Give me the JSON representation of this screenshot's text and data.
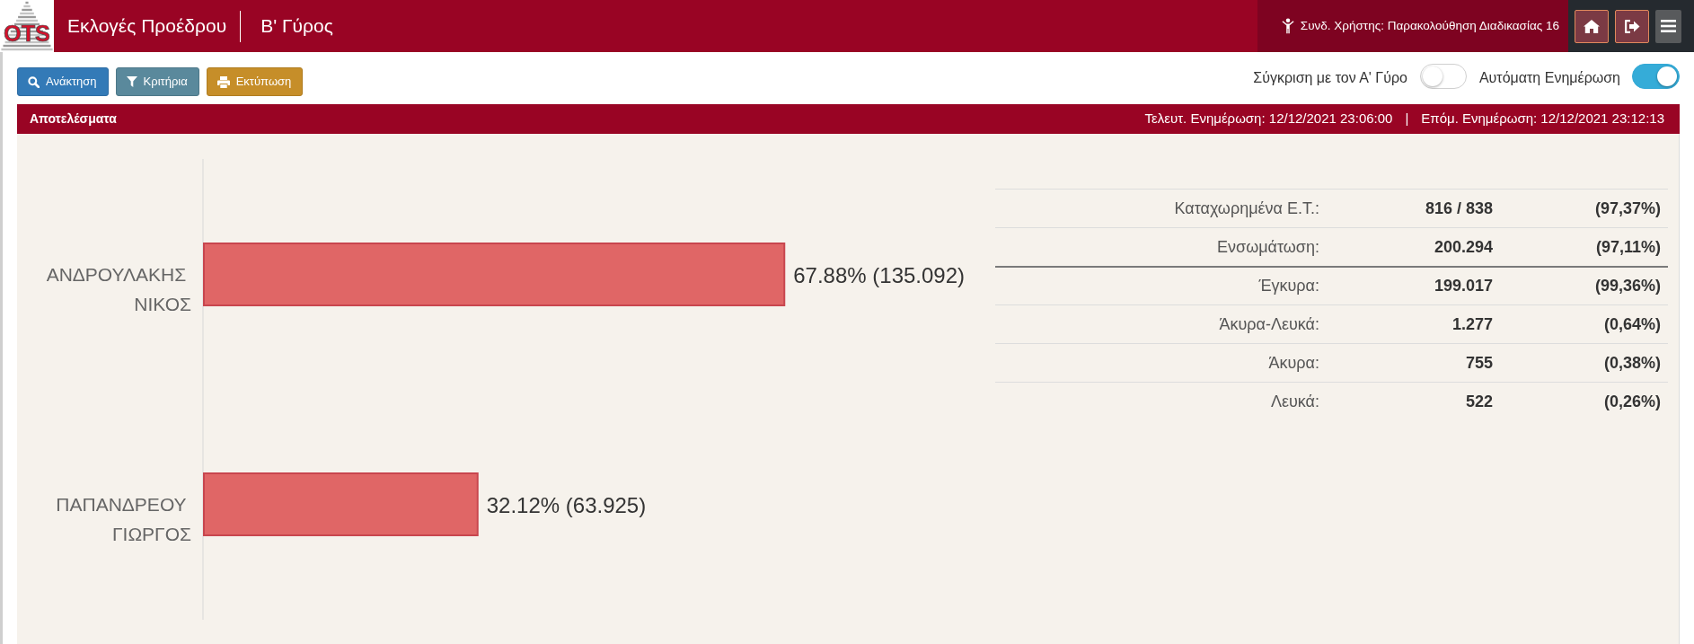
{
  "header": {
    "logo": "OTS",
    "title": "Εκλογές Προέδρου",
    "subtitle": "Β' Γύρος",
    "user": "Συνδ. Χρήστης: Παρακολούθηση Διαδικασίας 16"
  },
  "toolbar": {
    "buttons": [
      {
        "label": "Ανάκτηση",
        "kind": "search"
      },
      {
        "label": "Κριτήρια",
        "kind": "filter"
      },
      {
        "label": "Εκτύπωση",
        "kind": "print"
      }
    ]
  },
  "toggles": [
    {
      "label": "Σύγκριση με τον Α' Γύρο",
      "on": false
    },
    {
      "label": "Αυτόματη Ενημέρωση",
      "on": true
    }
  ],
  "results": {
    "title": "Αποτελέσματα",
    "last_update": "Τελευτ. Ενημέρωση: 12/12/2021 23:06:00",
    "separator": "|",
    "next_update": "Επόμ. Ενημέρωση: 12/12/2021 23:12:13",
    "chart_data": {
      "type": "bar",
      "orientation": "horizontal",
      "categories": [
        "ΑΝΔΡΟΥΛΑΚΗΣ ΝΙΚΟΣ",
        "ΠΑΠΑΝΔΡΕΟΥ ΓΙΩΡΓΟΣ"
      ],
      "values": [
        67.88,
        32.12
      ],
      "data_labels": true,
      "value_labels": [
        "67.88% (135.092)",
        "32.12% (63.925)"
      ]
    },
    "stats": {
      "sections": [
        {
          "rows": [
            {
              "label": "Καταχωρημένα Ε.Τ.:",
              "value": "816 / 838",
              "percent": "(97,37%)"
            },
            {
              "label": "Ενσωμάτωση:",
              "value": "200.294",
              "percent": "(97,11%)"
            }
          ]
        },
        {
          "rows": [
            {
              "label": "Έγκυρα:",
              "value": "199.017",
              "percent": "(99,36%)"
            },
            {
              "label": "Άκυρα-Λευκά:",
              "value": "1.277",
              "percent": "(0,64%)"
            },
            {
              "label": "Άκυρα:",
              "value": "755",
              "percent": "(0,38%)"
            },
            {
              "label": "Λευκά:",
              "value": "522",
              "percent": "(0,26%)"
            }
          ]
        }
      ]
    }
  }
}
